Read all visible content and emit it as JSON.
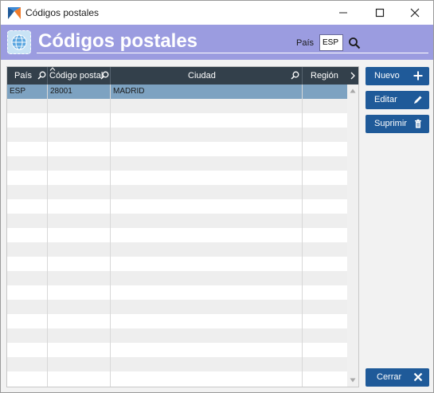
{
  "window": {
    "title": "Códigos postales",
    "icon": "app-logo-icon"
  },
  "window_controls": {
    "minimize_icon": "minimize-icon",
    "maximize_icon": "maximize-icon",
    "close_icon": "close-icon"
  },
  "header": {
    "logo_icon": "globe-stamp-icon",
    "title": "Códigos postales",
    "filter_label": "País",
    "filter_value": "ESP",
    "search_icon": "search-icon"
  },
  "colors": {
    "header_bg": "#9b9ce0",
    "grid_header_bg": "#33404b",
    "button_bg": "#1f5a99",
    "selected_row": "#7da2c1"
  },
  "grid": {
    "columns": [
      {
        "label": "País",
        "search_icon": "search-icon"
      },
      {
        "label": "Código postal",
        "search_icon": "search-icon",
        "sort_icon": "sort-asc-icon"
      },
      {
        "label": "Ciudad",
        "search_icon": "search-icon"
      },
      {
        "label": "Región",
        "scroll_icon": "chevron-right-icon"
      }
    ],
    "rows": [
      {
        "pais": "ESP",
        "codigo": "28001",
        "ciudad": "MADRID",
        "region": ""
      }
    ]
  },
  "buttons": {
    "new": {
      "label": "Nuevo",
      "icon": "plus-icon"
    },
    "edit": {
      "label": "Editar",
      "icon": "pencil-icon"
    },
    "delete": {
      "label": "Suprimir",
      "icon": "trash-icon"
    },
    "close": {
      "label": "Cerrar",
      "icon": "close-x-icon"
    }
  }
}
